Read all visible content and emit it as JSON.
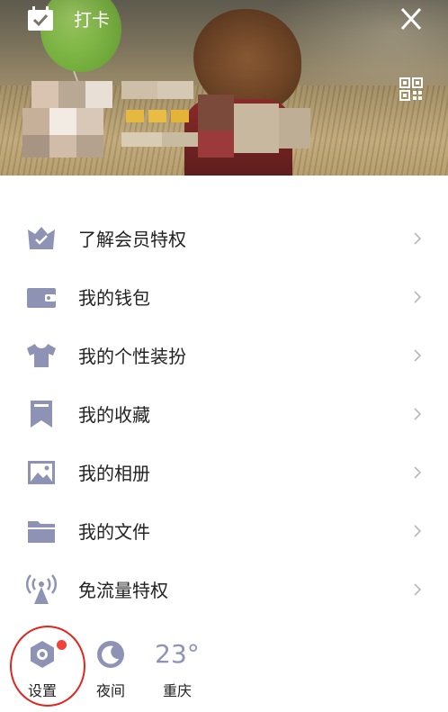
{
  "header": {
    "checkin_label": "打卡"
  },
  "menu": {
    "items": [
      {
        "label": "了解会员特权",
        "icon": "vip-crown-icon"
      },
      {
        "label": "我的钱包",
        "icon": "wallet-icon"
      },
      {
        "label": "我的个性装扮",
        "icon": "shirt-icon"
      },
      {
        "label": "我的收藏",
        "icon": "bookmark-icon"
      },
      {
        "label": "我的相册",
        "icon": "photo-icon"
      },
      {
        "label": "我的文件",
        "icon": "folder-icon"
      },
      {
        "label": "免流量特权",
        "icon": "signal-tower-icon"
      }
    ]
  },
  "bottom": {
    "settings_label": "设置",
    "night_label": "夜间",
    "temperature": "23°",
    "city": "重庆"
  },
  "colors": {
    "icon": "#8e93b5",
    "text": "#222222",
    "chevron": "#b8b8b8",
    "badge": "#f0423b",
    "highlight_ring": "#e0261f"
  }
}
